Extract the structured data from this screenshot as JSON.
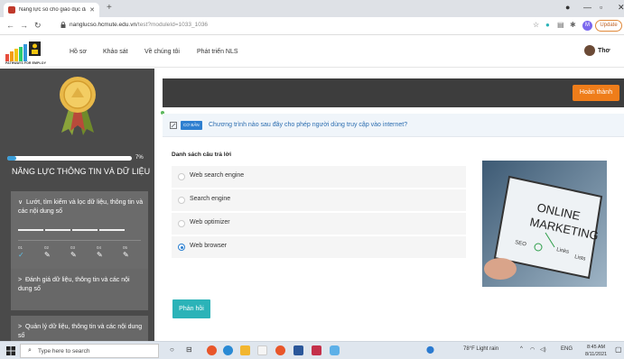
{
  "browser": {
    "tab_title": "Năng lực số cho giáo dục đại học",
    "url_host": "nanglucso.hcmute.edu.vn",
    "url_path": "/test?moduleId=1033_1036",
    "profile_initial": "M",
    "update_label": "Update"
  },
  "site": {
    "logo_text": "PATHWAYS FOR EMPLOY",
    "nav": [
      "Hồ sơ",
      "Khảo sát",
      "Về chúng tôi",
      "Phát triển NLS"
    ],
    "user_name": "Thơ"
  },
  "sidebar": {
    "progress_percent": 7,
    "progress_label": "7%",
    "section_title": "NĂNG LỰC THÔNG TIN VÀ DỮ LIỆU",
    "competencies": [
      {
        "chevron": "∨",
        "title": "Lướt, tìm kiếm và lọc dữ liệu, thông tin và các nội dung số",
        "subitems": [
          {
            "num": "01",
            "status": "done"
          },
          {
            "num": "02",
            "status": "todo"
          },
          {
            "num": "03",
            "status": "todo"
          },
          {
            "num": "04",
            "status": "todo"
          },
          {
            "num": "05",
            "status": "todo"
          }
        ]
      },
      {
        "chevron": ">",
        "title": "Đánh giá dữ liệu, thông tin và các nội dung số"
      },
      {
        "chevron": ">",
        "title": "Quản lý dữ liệu, thông tin và các nội dung số"
      }
    ]
  },
  "quiz": {
    "finish_label": "Hoàn thành",
    "level_badge": "CƠ BẢN",
    "question": "Chương trình nào sau đây cho phép người dùng truy cập vào internet?",
    "answers_title": "Danh sách câu trả lời",
    "options": [
      {
        "text": "Web search engine",
        "selected": false
      },
      {
        "text": "Search engine",
        "selected": false
      },
      {
        "text": "Web optimizer",
        "selected": false
      },
      {
        "text": "Web browser",
        "selected": true
      }
    ],
    "image_caption": "ONLINE MARKETING",
    "image_words": [
      "SEO",
      "Links",
      "Lists"
    ],
    "feedback_label": "Phản hồi"
  },
  "taskbar": {
    "search_placeholder": "Type here to search",
    "weather": "78°F Light rain",
    "language": "ENG",
    "time": "8:45 AM",
    "date": "8/11/2021"
  }
}
